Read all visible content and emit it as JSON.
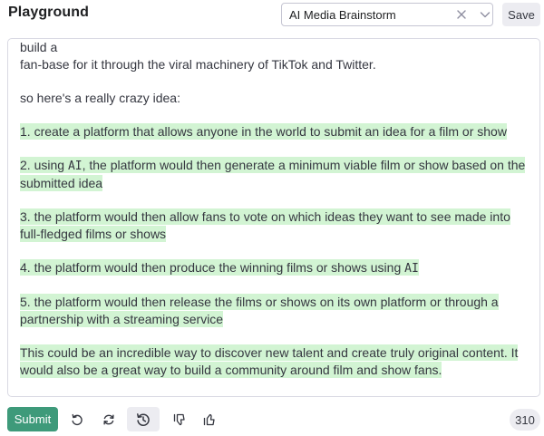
{
  "header": {
    "title": "Playground",
    "preset_value": "AI Media Brainstorm",
    "save_label": "Save"
  },
  "editor": {
    "cut_line": "connected writer in Brooklyn, she was able to quickly create a minimum viable film and build a",
    "line_partial": " fan-base for it through the viral machinery of TikTok and Twitter.",
    "intro": "so here's a really crazy idea:",
    "items": [
      {
        "pre": "1. create a platform that allows anyone in the world to submit an idea for a film or show",
        "ai": "",
        "post": ""
      },
      {
        "pre": "2. using ",
        "ai": "AI",
        "post": ", the platform would then generate a minimum viable film or show based on the submitted idea"
      },
      {
        "pre": "3. the platform would then allow fans to vote on which ideas they want to see made into full-fledged films or shows",
        "ai": "",
        "post": ""
      },
      {
        "pre": "4. the platform would then produce the winning films or shows using ",
        "ai": "AI",
        "post": ""
      },
      {
        "pre": "5. the platform would then release the films or shows on its own platform or through a partnership with a streaming service",
        "ai": "",
        "post": ""
      },
      {
        "pre": "This could be an incredible way to discover new talent and create truly original content. It would also be a great way to build a community around film and show fans.",
        "ai": "",
        "post": ""
      }
    ]
  },
  "footer": {
    "submit_label": "Submit",
    "token_count": "310"
  },
  "icons": {
    "clear": "x-icon",
    "dropdown": "chevron-down-icon",
    "undo": "undo-icon",
    "regenerate": "refresh-icon",
    "history": "history-icon",
    "thumbs_down": "thumbs-down-icon",
    "thumbs_up": "thumbs-up-icon"
  },
  "colors": {
    "highlight": "#d2f4d3",
    "submit": "#3e9a7a",
    "button_bg": "#ececf1"
  }
}
